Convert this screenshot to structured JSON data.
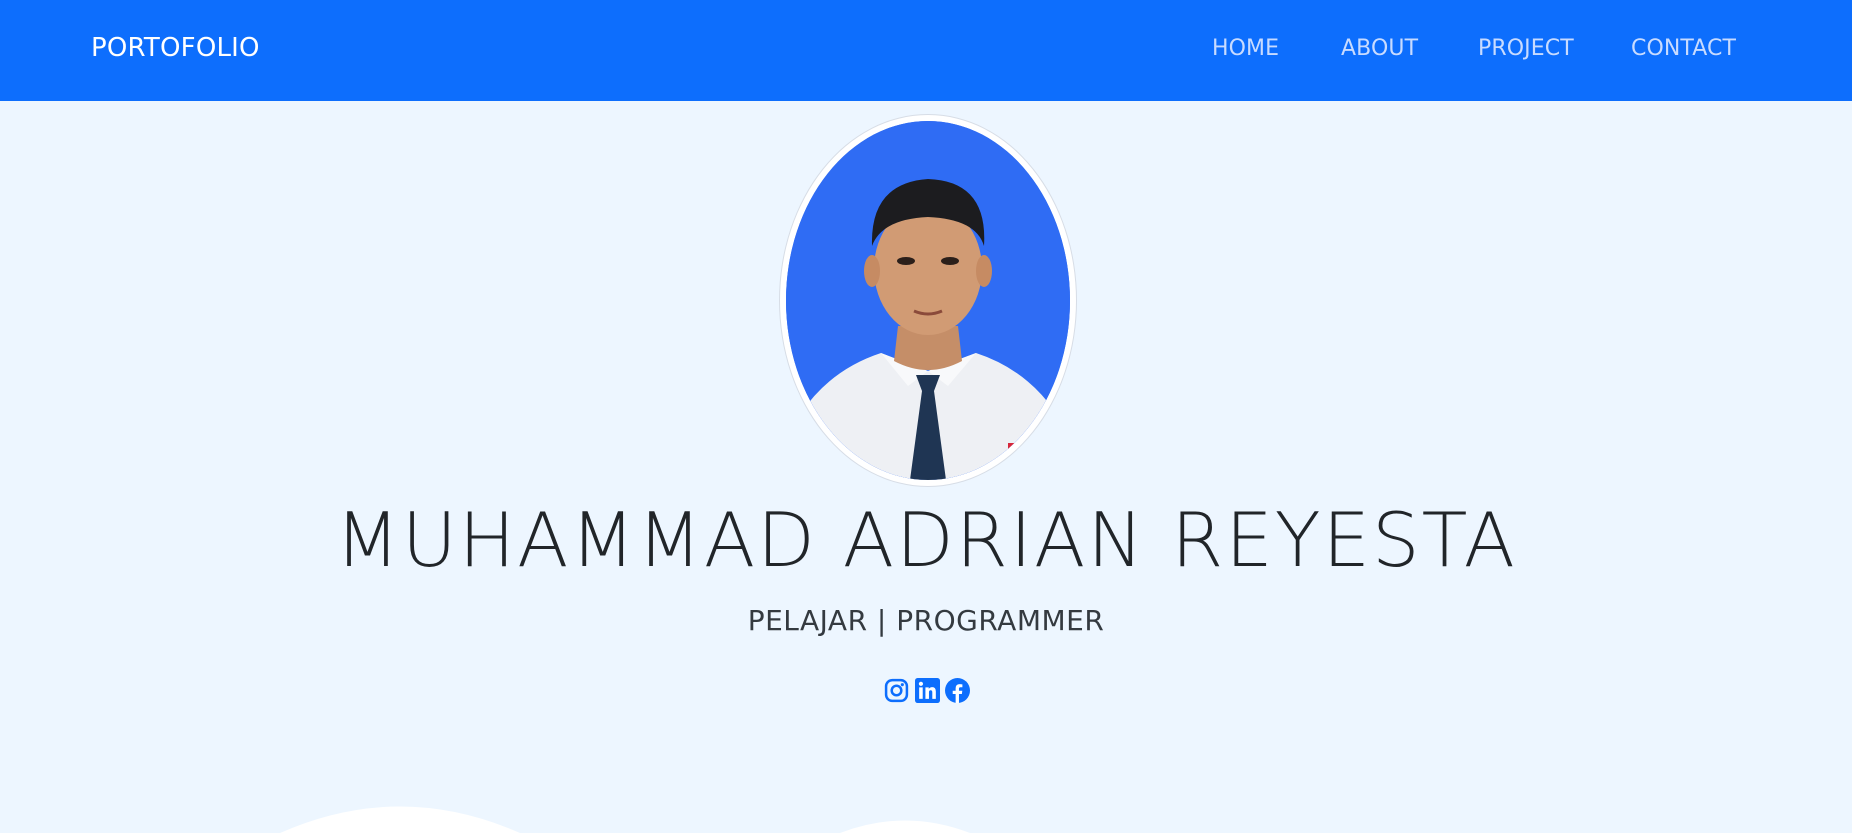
{
  "nav": {
    "brand": "PORTOFOLIO",
    "links": [
      {
        "label": "HOME"
      },
      {
        "label": "ABOUT"
      },
      {
        "label": "PROJECT"
      },
      {
        "label": "CONTACT"
      }
    ]
  },
  "hero": {
    "name": "MUHAMMAD ADRIAN REYESTA",
    "subtitle": "PELAJAR | PROGRAMMER",
    "photo_alt": "profile photo",
    "socials": [
      {
        "icon": "instagram-icon"
      },
      {
        "icon": "linkedin-icon"
      },
      {
        "icon": "facebook-icon"
      }
    ]
  },
  "colors": {
    "primary": "#0d6efd",
    "background": "#edf6ff",
    "text": "#212529",
    "nav_link": "#c8dbff"
  }
}
